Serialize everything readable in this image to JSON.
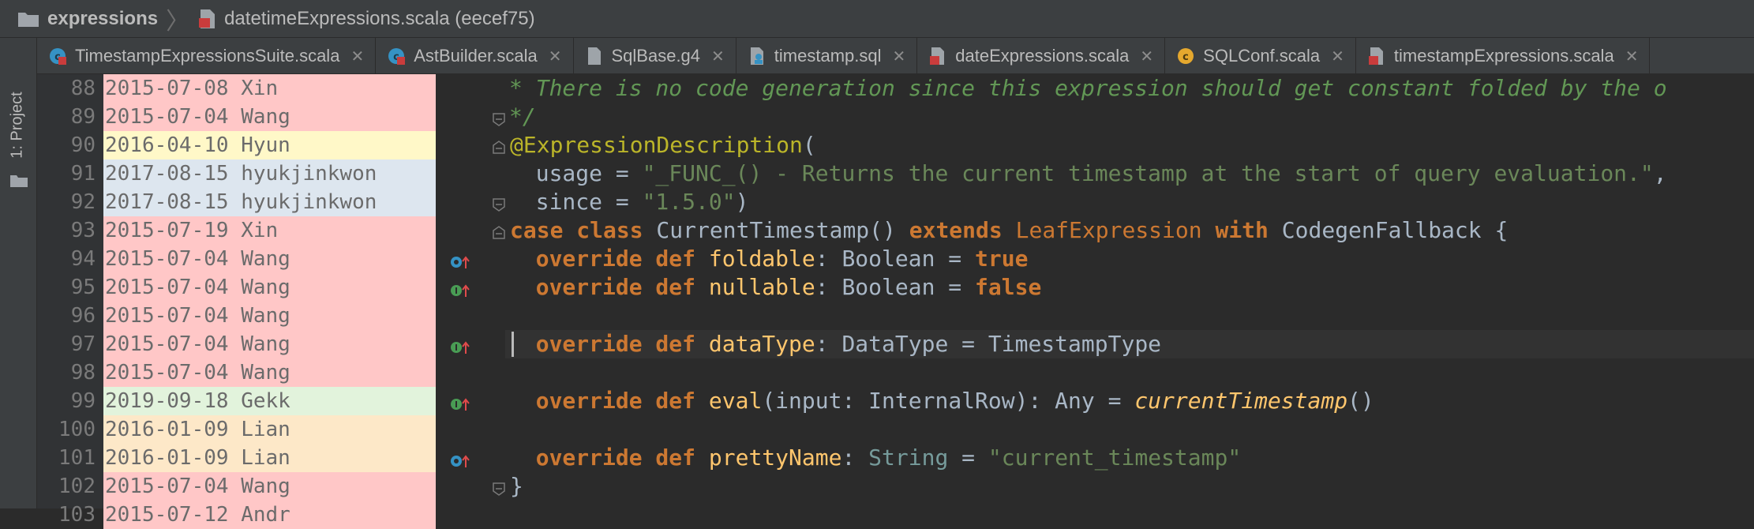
{
  "breadcrumb": {
    "project": "expressions",
    "file": "datetimeExpressions.scala (eecef75)"
  },
  "sidebar": {
    "project_label": "1: Project"
  },
  "tabs": [
    {
      "label": "TimestampExpressionsSuite.scala",
      "icon": "scala-class-icon"
    },
    {
      "label": "AstBuilder.scala",
      "icon": "scala-class-icon"
    },
    {
      "label": "SqlBase.g4",
      "icon": "antlr-file-icon"
    },
    {
      "label": "timestamp.sql",
      "icon": "sql-file-icon"
    },
    {
      "label": "dateExpressions.scala",
      "icon": "scala-file-icon"
    },
    {
      "label": "SQLConf.scala",
      "icon": "scala-class-icon"
    },
    {
      "label": "timestampExpressions.scala",
      "icon": "scala-file-icon"
    }
  ],
  "close_glyph": "✕",
  "annotations": [
    {
      "line": "88",
      "date": "2015-07-08",
      "author": "Xin"
    },
    {
      "line": "89",
      "date": "2015-07-04",
      "author": "Wang"
    },
    {
      "line": "90",
      "date": "2016-04-10",
      "author": "Hyun"
    },
    {
      "line": "91",
      "date": "2017-08-15",
      "author": "hyukjinkwon"
    },
    {
      "line": "92",
      "date": "2017-08-15",
      "author": "hyukjinkwon"
    },
    {
      "line": "93",
      "date": "2015-07-19",
      "author": "Xin"
    },
    {
      "line": "94",
      "date": "2015-07-04",
      "author": "Wang"
    },
    {
      "line": "95",
      "date": "2015-07-04",
      "author": "Wang"
    },
    {
      "line": "96",
      "date": "2015-07-04",
      "author": "Wang"
    },
    {
      "line": "97",
      "date": "2015-07-04",
      "author": "Wang"
    },
    {
      "line": "98",
      "date": "2015-07-04",
      "author": "Wang"
    },
    {
      "line": "99",
      "date": "2019-09-18",
      "author": "Gekk"
    },
    {
      "line": "100",
      "date": "2016-01-09",
      "author": "Lian"
    },
    {
      "line": "101",
      "date": "2016-01-09",
      "author": "Lian"
    },
    {
      "line": "102",
      "date": "2015-07-04",
      "author": "Wang"
    },
    {
      "line": "103",
      "date": "2015-07-12",
      "author": "Andr"
    }
  ],
  "code": {
    "l88": "* There is no code generation since this expression should get constant folded by the o",
    "l89": "*/",
    "l90_ann": "@ExpressionDescription",
    "l90_paren": "(",
    "l91_key": "  usage = ",
    "l91_str": "\"_FUNC_() - Returns the current timestamp at the start of query evaluation.\"",
    "l91_comma": ",",
    "l92_key": "  since = ",
    "l92_str": "\"1.5.0\"",
    "l92_paren": ")",
    "l93": {
      "kw1": "case class",
      "name": " CurrentTimestamp() ",
      "kw2": "extends",
      "parent": " LeafExpression ",
      "kw3": "with",
      "trait": " CodegenFallback {"
    },
    "l94": {
      "kw": "  override def",
      "name": " foldable",
      "rest": ": Boolean = ",
      "val": "true"
    },
    "l95": {
      "kw": "  override def",
      "name": " nullable",
      "rest": ": Boolean = ",
      "val": "false"
    },
    "l97": {
      "kw": "  override def",
      "name": " dataType",
      "rest": ": DataType = TimestampType"
    },
    "l99": {
      "kw": "  override def",
      "name": " eval",
      "rest": "(input: InternalRow): Any = ",
      "fn": "currentTimestamp",
      "end": "()"
    },
    "l101": {
      "kw": "  override def",
      "name": " prettyName",
      "rest": ": ",
      "type": "String",
      "eq": " = ",
      "str": "\"current_timestamp\""
    },
    "l102": "}"
  },
  "colors": {
    "ann_red": "#ffc7c7",
    "ann_yellow": "#fff8c8",
    "ann_blue": "#dde6ef",
    "ann_green": "#e2f3dc",
    "ann_orange": "#fde8c8"
  }
}
